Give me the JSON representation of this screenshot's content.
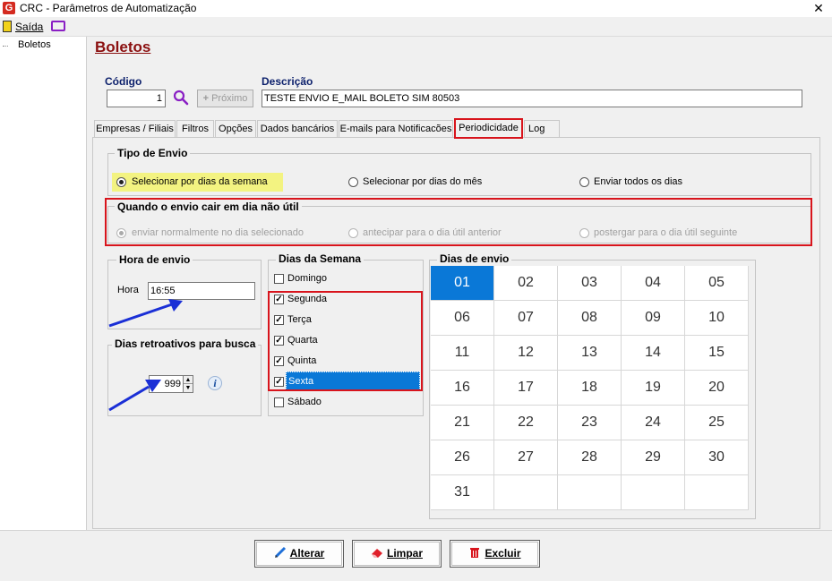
{
  "window": {
    "title": "CRC - Parâmetros de Automatização",
    "logo_letter": "G",
    "close_glyph": "✕"
  },
  "menu": {
    "exit_label": "Saída"
  },
  "tree": {
    "items": [
      {
        "label": "Boletos"
      }
    ]
  },
  "header": {
    "page_title": "Boletos",
    "code_label": "Código",
    "code_value": "1",
    "next_label": "Próximo",
    "description_label": "Descrição",
    "description_value": "TESTE ENVIO  E_MAIL BOLETO SIM 80503"
  },
  "tabs": [
    {
      "label": "Empresas / Filiais"
    },
    {
      "label": "Filtros"
    },
    {
      "label": "Opções"
    },
    {
      "label": "Dados bancários"
    },
    {
      "label": "E-mails para Notificacões"
    },
    {
      "label": "Periodicidade",
      "active": true
    },
    {
      "label": "Log"
    }
  ],
  "send_type": {
    "title": "Tipo de Envio",
    "options": [
      {
        "label": "Selecionar por dias da semana",
        "selected": true
      },
      {
        "label": "Selecionar por dias do mês",
        "selected": false
      },
      {
        "label": "Enviar todos os dias",
        "selected": false
      }
    ]
  },
  "non_business_day": {
    "title": "Quando o envio cair em dia não útil",
    "options": [
      {
        "label": "enviar normalmente no dia selecionado",
        "selected": true
      },
      {
        "label": "antecipar para o dia útil anterior",
        "selected": false
      },
      {
        "label": "postergar para o dia útil seguinte",
        "selected": false
      }
    ]
  },
  "send_time": {
    "title": "Hora de envio",
    "label": "Hora",
    "value": "16:55"
  },
  "retro_days": {
    "title": "Dias retroativos para busca",
    "value": "999"
  },
  "weekdays": {
    "title": "Dias da Semana",
    "items": [
      {
        "label": "Domingo",
        "checked": false
      },
      {
        "label": "Segunda",
        "checked": true
      },
      {
        "label": "Terça",
        "checked": true
      },
      {
        "label": "Quarta",
        "checked": true
      },
      {
        "label": "Quinta",
        "checked": true
      },
      {
        "label": "Sexta",
        "checked": true,
        "highlighted": true
      },
      {
        "label": "Sábado",
        "checked": false
      }
    ]
  },
  "send_days": {
    "title": "Dias de envio",
    "days": [
      "01",
      "02",
      "03",
      "04",
      "05",
      "06",
      "07",
      "08",
      "09",
      "10",
      "11",
      "12",
      "13",
      "14",
      "15",
      "16",
      "17",
      "18",
      "19",
      "20",
      "21",
      "22",
      "23",
      "24",
      "25",
      "26",
      "27",
      "28",
      "29",
      "30",
      "31"
    ],
    "selected": "01"
  },
  "actions": {
    "edit_label": "Alterar",
    "clear_label": "Limpar",
    "delete_label": "Excluir"
  },
  "colors": {
    "title_red": "#8b1010",
    "label_blue": "#0b1f6b",
    "highlight_red": "#d8141c",
    "selection_blue": "#0a78d7",
    "yellow_highlight": "#f3f381",
    "arrow_blue": "#1a2fd6"
  }
}
